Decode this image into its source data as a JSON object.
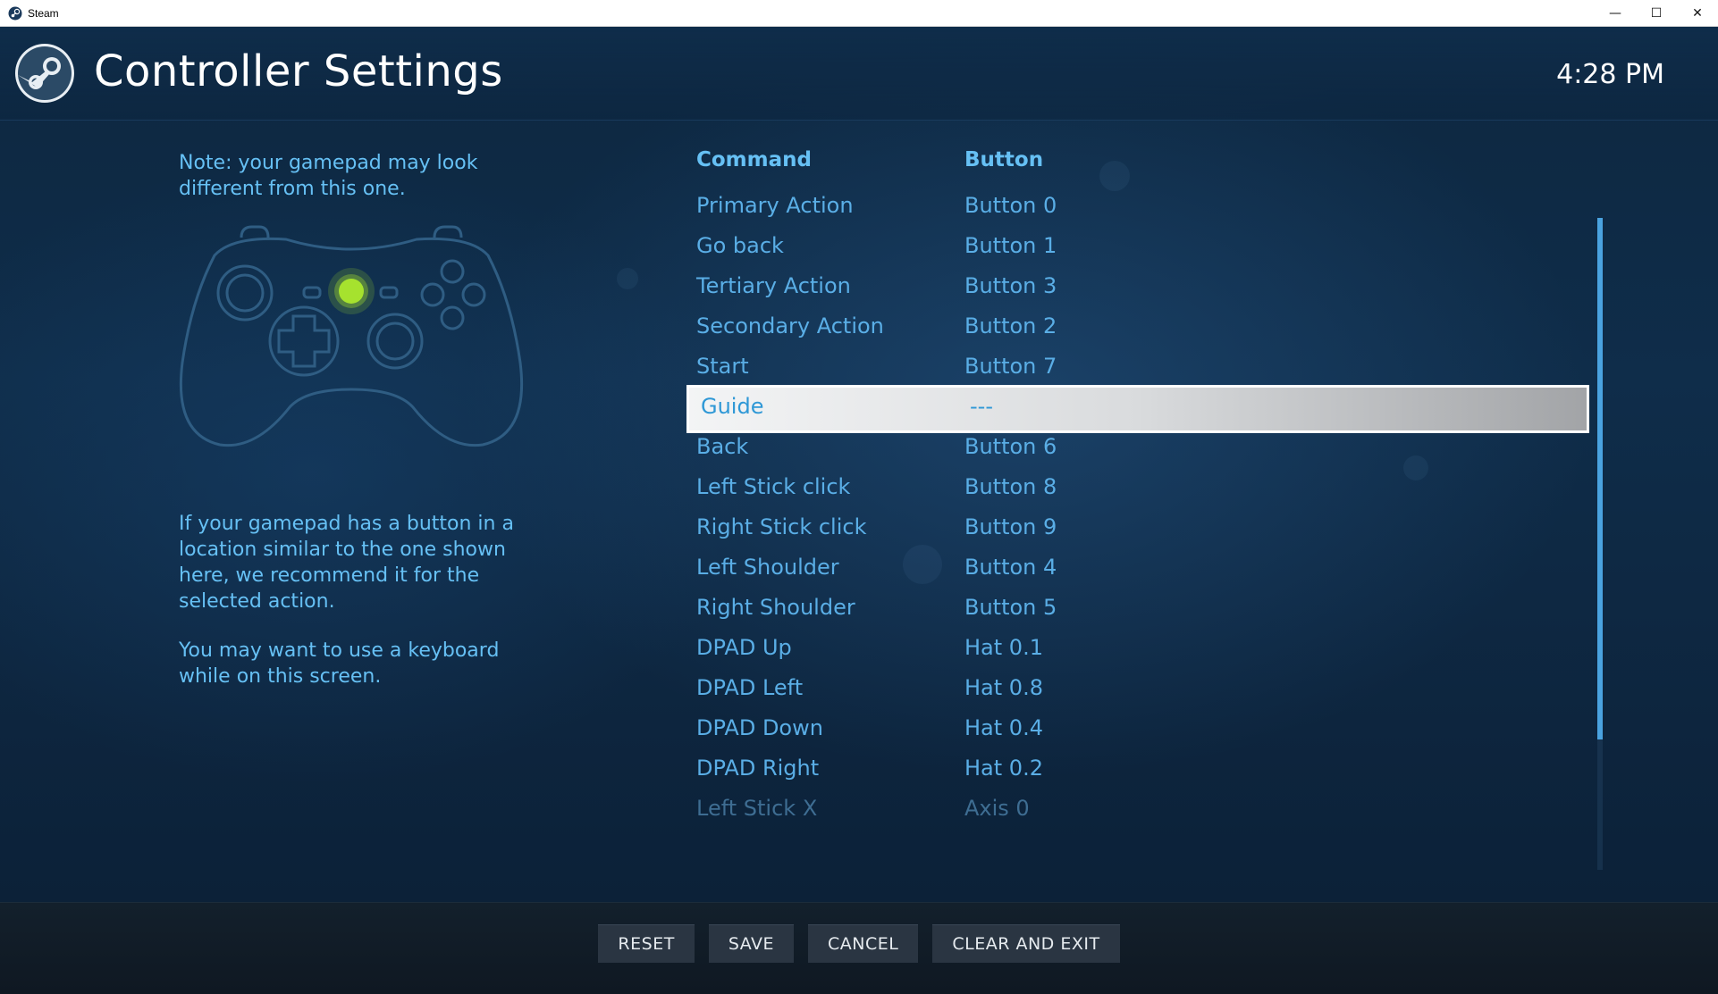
{
  "window": {
    "title": "Steam",
    "minimize_glyph": "—",
    "maximize_glyph": "☐",
    "close_glyph": "✕"
  },
  "header": {
    "title": "Controller Settings",
    "clock": "4:28 PM"
  },
  "left_panel": {
    "note": "Note: your gamepad may look different from this one.",
    "help": "If your gamepad has a button in a location similar to the one shown here, we recommend it for the selected action.",
    "tip": "You may want to use a keyboard while on this screen."
  },
  "table": {
    "col_command": "Command",
    "col_button": "Button",
    "rows": [
      {
        "command": "Primary Action",
        "button": "Button 0"
      },
      {
        "command": "Go back",
        "button": "Button 1"
      },
      {
        "command": "Tertiary Action",
        "button": "Button 3"
      },
      {
        "command": "Secondary Action",
        "button": "Button 2"
      },
      {
        "command": "Start",
        "button": "Button 7"
      },
      {
        "command": "Guide",
        "button": "---"
      },
      {
        "command": "Back",
        "button": "Button 6"
      },
      {
        "command": "Left Stick click",
        "button": "Button 8"
      },
      {
        "command": "Right Stick click",
        "button": "Button 9"
      },
      {
        "command": "Left Shoulder",
        "button": "Button 4"
      },
      {
        "command": "Right Shoulder",
        "button": "Button 5"
      },
      {
        "command": "DPAD Up",
        "button": "Hat 0.1"
      },
      {
        "command": "DPAD Left",
        "button": "Hat 0.8"
      },
      {
        "command": "DPAD Down",
        "button": "Hat 0.4"
      },
      {
        "command": "DPAD Right",
        "button": "Hat 0.2"
      },
      {
        "command": "Left Stick X",
        "button": "Axis 0"
      }
    ]
  },
  "footer": {
    "reset": "RESET",
    "save": "SAVE",
    "cancel": "CANCEL",
    "clear_exit": "CLEAR AND EXIT"
  },
  "colors": {
    "accent": "#66c0f4",
    "highlight_button": "#a6e22e"
  },
  "icons": {
    "app": "steam-logo-icon",
    "gamepad": "gamepad-diagram-icon"
  }
}
